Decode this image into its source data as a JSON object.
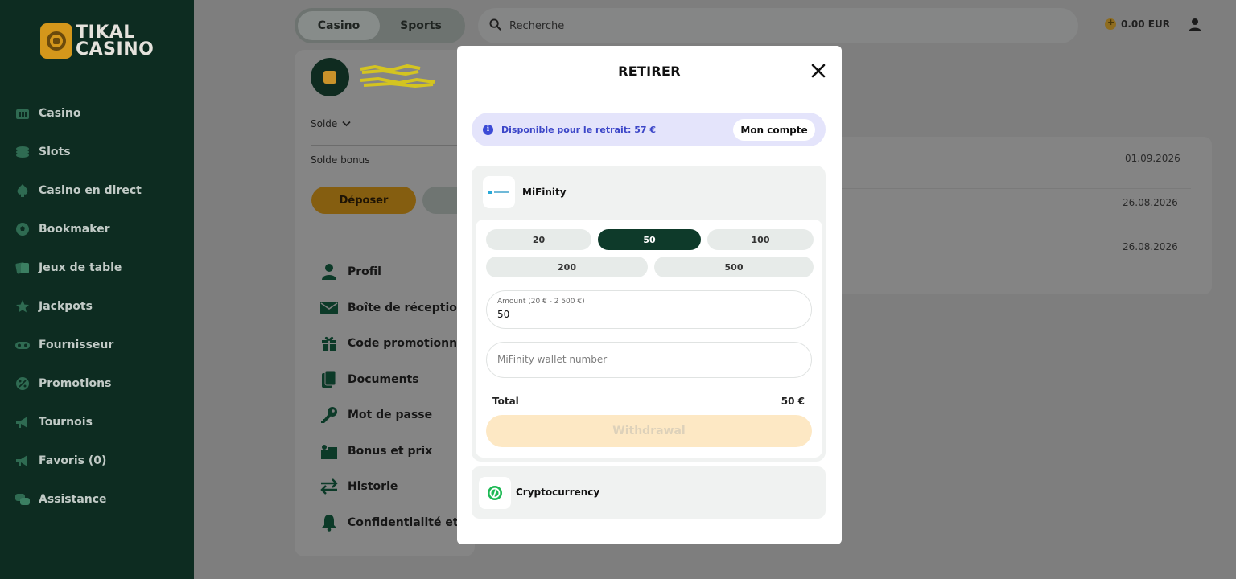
{
  "brand": {
    "line1": "TIKAL",
    "line2": "CASINO"
  },
  "sidebar": {
    "items": [
      {
        "label": "Casino",
        "icon": "casino-icon"
      },
      {
        "label": "Slots",
        "icon": "slots-icon"
      },
      {
        "label": "Casino en direct",
        "icon": "live-casino-icon"
      },
      {
        "label": "Bookmaker",
        "icon": "ball-icon"
      },
      {
        "label": "Jeux de table",
        "icon": "cards-icon"
      },
      {
        "label": "Jackpots",
        "icon": "star-icon"
      },
      {
        "label": "Fournisseur",
        "icon": "provider-icon"
      },
      {
        "label": "Promotions",
        "icon": "percent-icon"
      },
      {
        "label": "Tournois",
        "icon": "megaphone-icon"
      },
      {
        "label": "Favoris (0)",
        "icon": "favorites-icon"
      },
      {
        "label": "Assistance",
        "icon": "chat-icon"
      }
    ]
  },
  "header": {
    "tabs": [
      {
        "label": "Casino"
      },
      {
        "label": "Sports"
      }
    ],
    "search_placeholder": "Recherche",
    "balance": "0.00 EUR"
  },
  "profile": {
    "solde_label": "Solde",
    "solde_bonus_label": "Solde bonus",
    "deposit_label": "Déposer",
    "menu": [
      {
        "label": "Profil",
        "icon": "user-icon"
      },
      {
        "label": "Boîte de réception",
        "icon": "envelope-icon"
      },
      {
        "label": "Code promotionnel",
        "icon": "gift-icon"
      },
      {
        "label": "Documents",
        "icon": "documents-icon"
      },
      {
        "label": "Mot de passe",
        "icon": "key-icon"
      },
      {
        "label": "Bonus et prix",
        "icon": "bonus-icon"
      },
      {
        "label": "Historie",
        "icon": "swap-icon"
      },
      {
        "label": "Confidentialité et no",
        "icon": "bell-icon"
      }
    ]
  },
  "history": {
    "dates": [
      "01.09.2026",
      "26.08.2026",
      "26.08.2026"
    ]
  },
  "modal": {
    "title": "RETIRER",
    "info_text": "Disponible pour le retrait: 57 €",
    "account_button": "Mon compte",
    "method_name": "MiFinity",
    "amount_chips": [
      "20",
      "50",
      "100",
      "200",
      "500"
    ],
    "selected_chip": "50",
    "amount_label": "Amount (20 € - 2 500 €)",
    "amount_value": "50",
    "wallet_placeholder": "MiFinity wallet number",
    "total_label": "Total",
    "total_value": "50 €",
    "withdraw_button": "Withdrawal",
    "crypto_name": "Cryptocurrency"
  },
  "colors": {
    "sidebar_bg": "#0d2c21",
    "accent_green": "#0e3a2a",
    "info_text": "#3c46c8",
    "withdraw_disabled": "#fde8c4"
  }
}
